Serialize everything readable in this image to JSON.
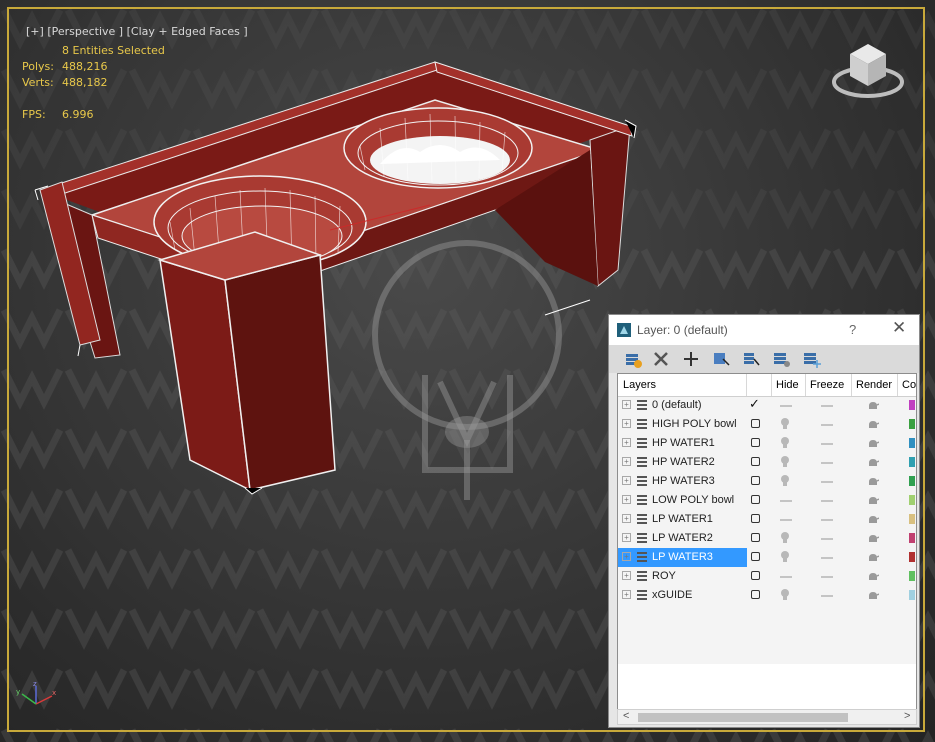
{
  "viewport": {
    "label_parts": [
      "[+]",
      "[Perspective ]",
      "[Clay + Edged Faces ]"
    ],
    "stats": {
      "selection": "8 Entities Selected",
      "polys_label": "Polys:",
      "polys_value": "488,216",
      "verts_label": "Verts:",
      "verts_value": "488,182",
      "fps_label": "FPS:",
      "fps_value": "6.996"
    },
    "gizmo_axes": [
      "z",
      "x",
      "y"
    ]
  },
  "layer_dialog": {
    "title": "Layer: 0 (default)",
    "help": "?",
    "close": "✕",
    "toolbar_icons": [
      "create-layer-icon",
      "delete-layer-icon",
      "add-to-layer-icon",
      "select-in-layer-icon",
      "highlight-layer-icon",
      "hide-all-icon",
      "freeze-all-icon"
    ],
    "columns": [
      "Layers",
      "Hide",
      "Freeze",
      "Render",
      "Co"
    ],
    "rows": [
      {
        "name": "0 (default)",
        "current": true,
        "hidden": false,
        "color": "#c040c0"
      },
      {
        "name": "HIGH POLY bowl",
        "current": false,
        "hidden": true,
        "color": "#3aa040"
      },
      {
        "name": "HP WATER1",
        "current": false,
        "hidden": true,
        "color": "#3090c0"
      },
      {
        "name": "HP WATER2",
        "current": false,
        "hidden": true,
        "color": "#30a0b0"
      },
      {
        "name": "HP WATER3",
        "current": false,
        "hidden": true,
        "color": "#30a050"
      },
      {
        "name": "LOW POLY bowl",
        "current": false,
        "hidden": false,
        "color": "#a0d070"
      },
      {
        "name": "LP WATER1",
        "current": false,
        "hidden": false,
        "color": "#d8c080"
      },
      {
        "name": "LP WATER2",
        "current": false,
        "hidden": true,
        "color": "#c04070"
      },
      {
        "name": "LP WATER3",
        "current": false,
        "hidden": true,
        "selected": true,
        "color": "#b03030"
      },
      {
        "name": "ROY",
        "current": false,
        "hidden": false,
        "color": "#60c060"
      },
      {
        "name": "xGUIDE",
        "current": false,
        "hidden": true,
        "color": "#a0d0e0"
      }
    ],
    "scroll_left": "<",
    "scroll_right": ">"
  },
  "colors": {
    "viewport_border": "#c8a93a",
    "stats_text": "#e8c84a",
    "model_red": "#8b1e1a",
    "selection_blue": "#3399ff"
  }
}
